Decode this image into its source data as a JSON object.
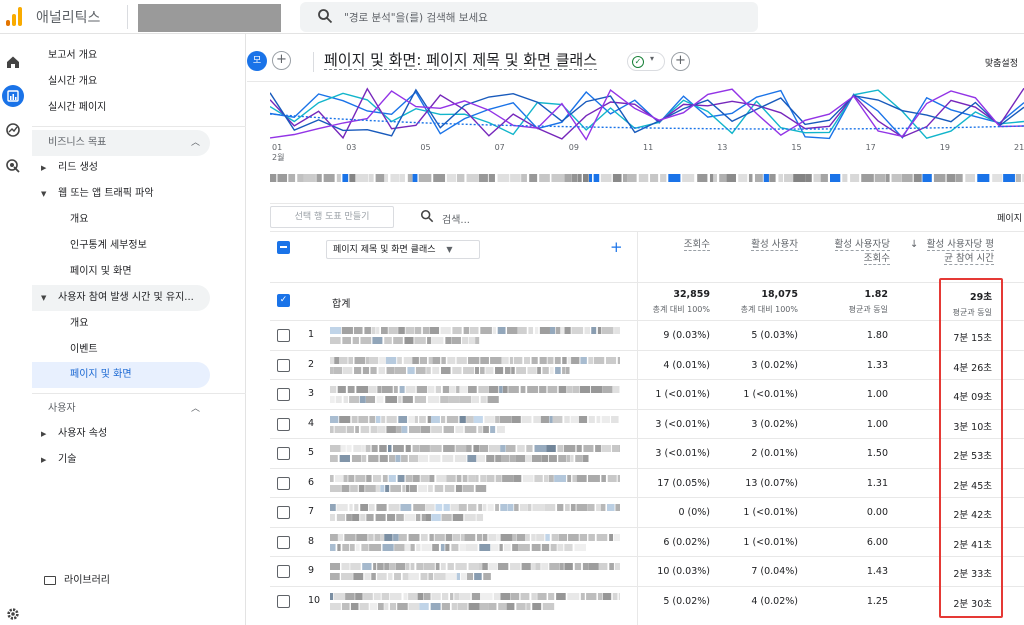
{
  "app": {
    "title": "애널리틱스",
    "search_placeholder": "\"경로 분석\"을(를) 검색해 보세요",
    "brand_colors": [
      "#f9ab00",
      "#e37400"
    ]
  },
  "rail": {
    "icons": [
      "home-icon",
      "reports-icon",
      "explore-icon",
      "advertising-icon"
    ],
    "settings_icon": "gear-icon"
  },
  "sidebar": {
    "top_items": [
      "보고서 개요",
      "실시간 개요",
      "실시간 페이지"
    ],
    "business_section": "비즈니스 목표",
    "lead": "리드 생성",
    "traffic": "웹 또는 앱 트래픽 파악",
    "traffic_children": [
      "개요",
      "인구통계 세부정보",
      "페이지 및 화면"
    ],
    "engagement": "사용자 참여 발생 시간 및 유지...",
    "engagement_children": [
      "개요",
      "이벤트",
      "페이지 및 화면"
    ],
    "user_section": "사용자",
    "user_attr": "사용자 속성",
    "tech": "기술",
    "library": "라이브러리"
  },
  "header": {
    "badge": "모",
    "title": "페이지 및 화면: 페이지 제목 및 화면 클래스",
    "customize": "맞춤설정"
  },
  "chart_data": {
    "type": "line",
    "x_ticks": [
      "01",
      "03",
      "05",
      "07",
      "09",
      "11",
      "13",
      "15",
      "17",
      "19",
      "21"
    ],
    "month_label": "2월",
    "series_colors": [
      "#1a73e8",
      "#12b5cb",
      "#7627bb",
      "#185abc",
      "#9334e6"
    ]
  },
  "toolbar": {
    "make_chart": "선택 행 도표 만들기",
    "search": "검색...",
    "pagination": "페이지"
  },
  "table": {
    "dimension": "페이지 제목 및 화면 클래스",
    "columns": [
      "조회수",
      "활성 사용자",
      "활성 사용자당 조회수",
      "활성 사용자당 평균 참여 시간"
    ],
    "total": {
      "label": "합계",
      "views": "32,859",
      "views_sub": "총계 대비 100%",
      "users": "18,075",
      "users_sub": "총계 대비 100%",
      "per_user": "1.82",
      "per_user_sub": "평균과 동일",
      "time": "29초",
      "time_sub": "평균과 동일"
    },
    "rows": [
      {
        "idx": "1",
        "views": "9 (0.03%)",
        "users": "5 (0.03%)",
        "per_user": "1.80",
        "time": "7분 15초"
      },
      {
        "idx": "2",
        "views": "4 (0.01%)",
        "users": "3 (0.02%)",
        "per_user": "1.33",
        "time": "4분 26초"
      },
      {
        "idx": "3",
        "views": "1 (<0.01%)",
        "users": "1 (<0.01%)",
        "per_user": "1.00",
        "time": "4분 09초"
      },
      {
        "idx": "4",
        "views": "3 (<0.01%)",
        "users": "3 (0.02%)",
        "per_user": "1.00",
        "time": "3분 10초"
      },
      {
        "idx": "5",
        "views": "3 (<0.01%)",
        "users": "2 (0.01%)",
        "per_user": "1.50",
        "time": "2분 53초"
      },
      {
        "idx": "6",
        "views": "17 (0.05%)",
        "users": "13 (0.07%)",
        "per_user": "1.31",
        "time": "2분 45초"
      },
      {
        "idx": "7",
        "views": "0 (0%)",
        "users": "1 (<0.01%)",
        "per_user": "0.00",
        "time": "2분 42초"
      },
      {
        "idx": "8",
        "views": "6 (0.02%)",
        "users": "1 (<0.01%)",
        "per_user": "6.00",
        "time": "2분 41초"
      },
      {
        "idx": "9",
        "views": "10 (0.03%)",
        "users": "7 (0.04%)",
        "per_user": "1.43",
        "time": "2분 33초"
      },
      {
        "idx": "10",
        "views": "5 (0.02%)",
        "users": "4 (0.02%)",
        "per_user": "1.25",
        "time": "2분 30초"
      }
    ],
    "highlight_color": "#e53935"
  }
}
